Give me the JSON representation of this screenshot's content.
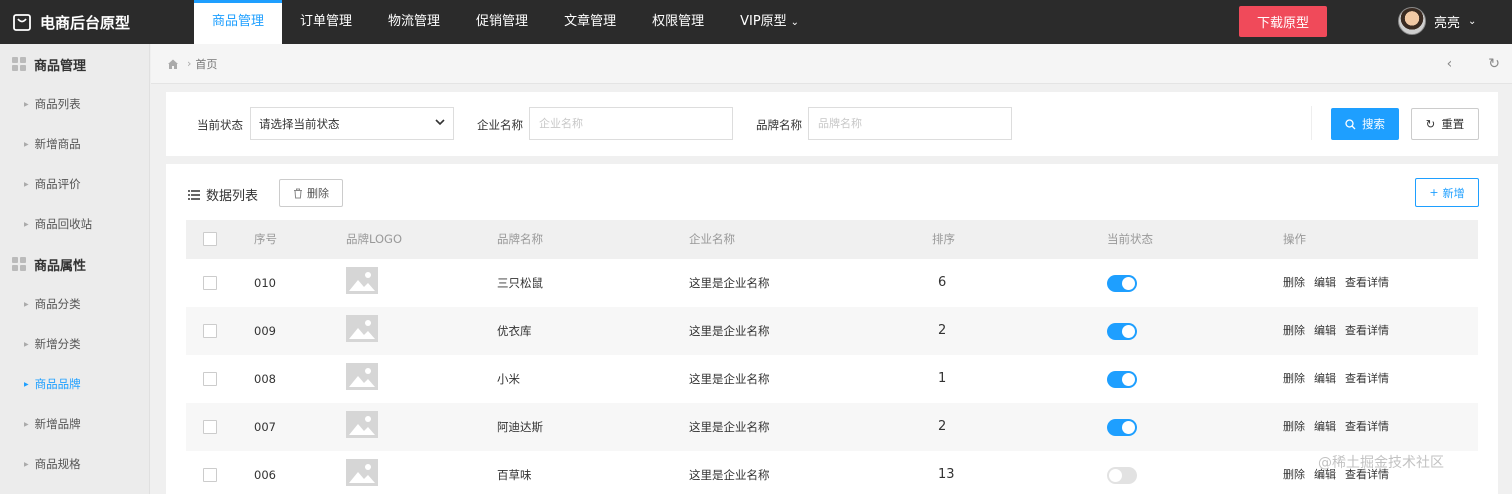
{
  "app": {
    "title": "电商后台原型"
  },
  "topnav": [
    {
      "label": "商品管理",
      "active": true
    },
    {
      "label": "订单管理",
      "active": false
    },
    {
      "label": "物流管理",
      "active": false
    },
    {
      "label": "促销管理",
      "active": false
    },
    {
      "label": "文章管理",
      "active": false
    },
    {
      "label": "权限管理",
      "active": false
    },
    {
      "label": "VIP原型",
      "active": false
    }
  ],
  "header": {
    "download_label": "下载原型",
    "user_name": "亮亮"
  },
  "sidebar": {
    "group1": "商品管理",
    "group1_items": [
      "商品列表",
      "新增商品",
      "商品评价",
      "商品回收站"
    ],
    "group2": "商品属性",
    "group2_items": [
      "商品分类",
      "新增分类",
      "商品品牌",
      "新增品牌",
      "商品规格"
    ],
    "active_item": "商品品牌"
  },
  "breadcrumb": {
    "home": "首页"
  },
  "filter": {
    "status_label": "当前状态",
    "status_value": "请选择当前状态",
    "company_label": "企业名称",
    "company_placeholder": "企业名称",
    "brand_label": "品牌名称",
    "brand_placeholder": "品牌名称",
    "search_label": "搜索",
    "reset_label": "重置"
  },
  "panel": {
    "title": "数据列表",
    "delete_label": "删除",
    "add_label": "新增"
  },
  "table": {
    "headers": [
      "序号",
      "品牌LOGO",
      "品牌名称",
      "企业名称",
      "排序",
      "当前状态",
      "操作"
    ],
    "rows": [
      {
        "id": "010",
        "brand": "三只松鼠",
        "company": "这里是企业名称",
        "sort": "6",
        "enabled": true
      },
      {
        "id": "009",
        "brand": "优衣库",
        "company": "这里是企业名称",
        "sort": "2",
        "enabled": true
      },
      {
        "id": "008",
        "brand": "小米",
        "company": "这里是企业名称",
        "sort": "1",
        "enabled": true
      },
      {
        "id": "007",
        "brand": "阿迪达斯",
        "company": "这里是企业名称",
        "sort": "2",
        "enabled": true
      },
      {
        "id": "006",
        "brand": "百草味",
        "company": "这里是企业名称",
        "sort": "13",
        "enabled": false
      }
    ],
    "actions": [
      "删除",
      "编辑",
      "查看详情"
    ]
  },
  "watermark": "@稀土掘金技术社区",
  "colors": {
    "primary": "#1e9fff",
    "download": "#f04a5a",
    "topbar": "#2b2b2b"
  }
}
